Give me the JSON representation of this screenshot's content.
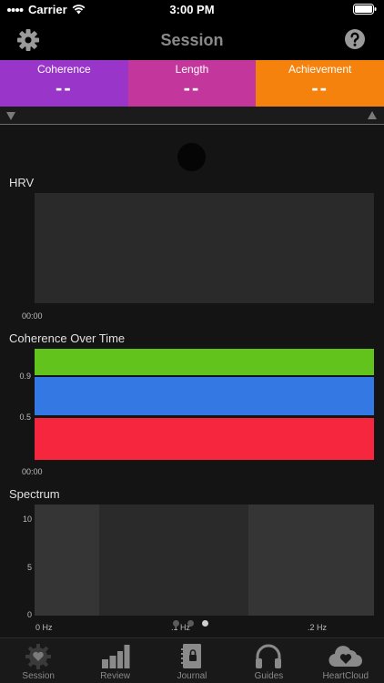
{
  "status_bar": {
    "carrier": "Carrier",
    "time": "3:00 PM"
  },
  "nav": {
    "title": "Session"
  },
  "stats": [
    {
      "label": "Coherence",
      "value": "--",
      "color": "#9a35c9"
    },
    {
      "label": "Length",
      "value": "--",
      "color": "#c3379c"
    },
    {
      "label": "Achievement",
      "value": "--",
      "color": "#f5820d"
    }
  ],
  "hrv": {
    "title": "HRV",
    "time_label": "00:00"
  },
  "coherence_over_time": {
    "title": "Coherence Over Time",
    "time_label": "00:00",
    "levels": [
      "0.9",
      "0.5"
    ],
    "band_colors": {
      "high": "#63c31d",
      "medium": "#3478e4",
      "low": "#f7263f"
    }
  },
  "spectrum": {
    "title": "Spectrum",
    "y_ticks": [
      "10",
      "5",
      "0"
    ],
    "x_ticks": [
      "0 Hz",
      ".1 Hz",
      ".2 Hz"
    ]
  },
  "pager": {
    "pages": 3,
    "active": 2
  },
  "tabs": [
    {
      "label": "Session",
      "icon": "heart-badge-icon"
    },
    {
      "label": "Review",
      "icon": "bar-chart-icon"
    },
    {
      "label": "Journal",
      "icon": "journal-icon"
    },
    {
      "label": "Guides",
      "icon": "headphones-icon"
    },
    {
      "label": "HeartCloud",
      "icon": "cloud-heart-icon"
    }
  ]
}
